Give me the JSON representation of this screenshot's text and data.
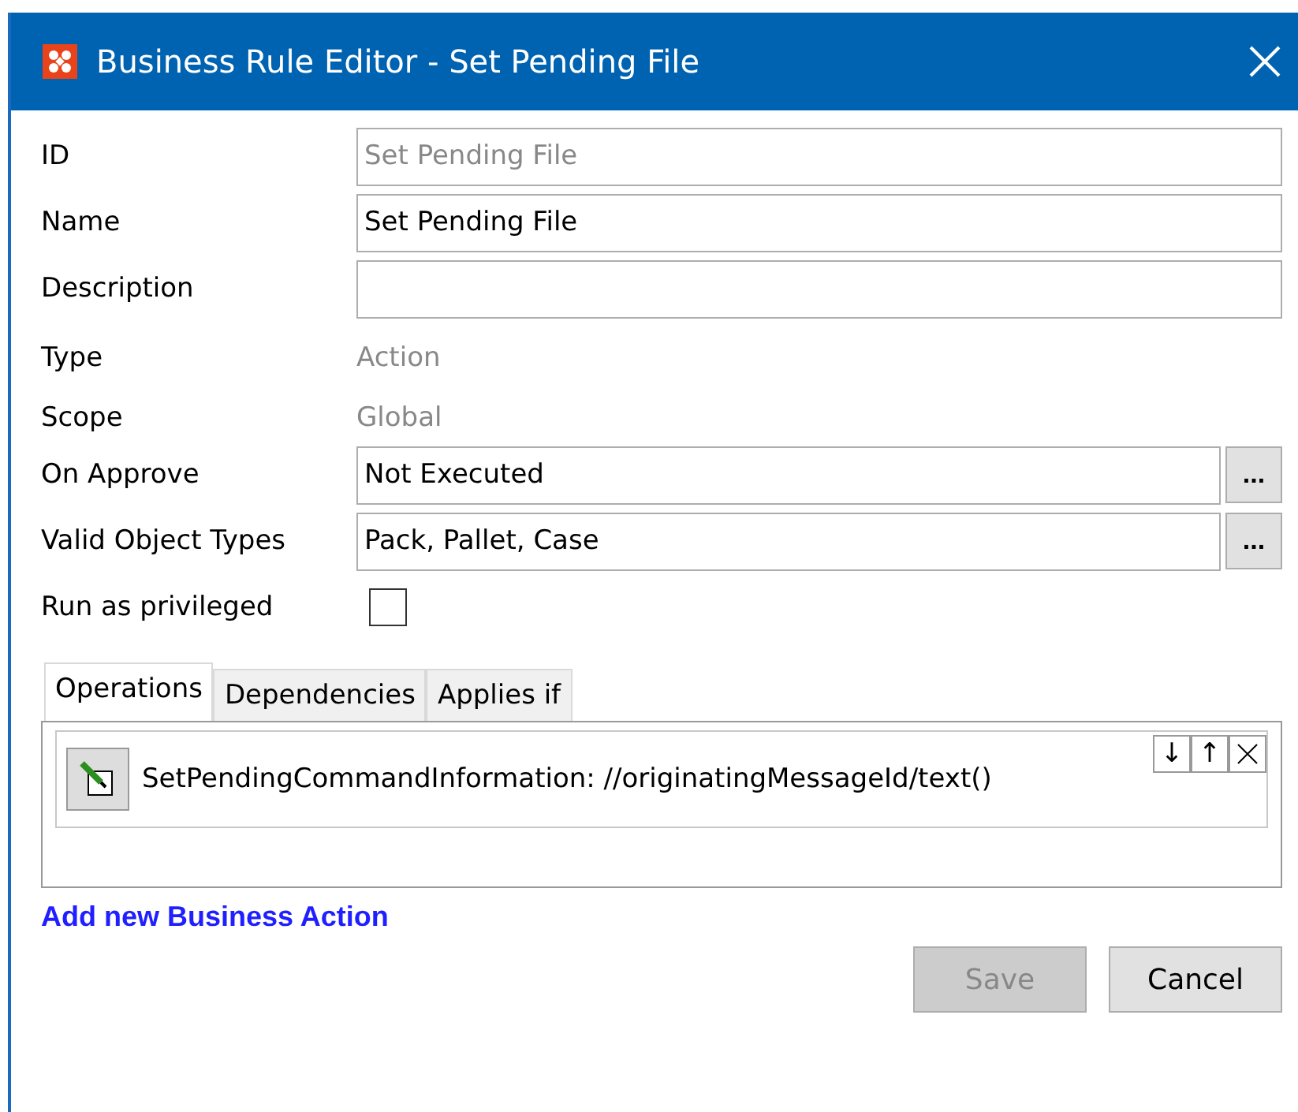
{
  "window": {
    "title": "Business Rule Editor - Set Pending File"
  },
  "fields": [
    {
      "label": "ID",
      "kind": "input",
      "value": "Set Pending File",
      "disabled": true
    },
    {
      "label": "Name",
      "kind": "input",
      "value": "Set Pending File",
      "disabled": false
    },
    {
      "label": "Description",
      "kind": "input"
    },
    {
      "label": "Type",
      "kind": "text",
      "value": "Action"
    },
    {
      "label": "Scope",
      "kind": "text",
      "value": "Global"
    },
    {
      "label": "On Approve",
      "kind": "browse",
      "value": "Not Executed",
      "button": "..."
    },
    {
      "label": "Valid Object Types",
      "kind": "browse",
      "value": "Pack, Pallet, Case",
      "button": "..."
    },
    {
      "label": "Run as privileged",
      "kind": "checkbox",
      "checked": false
    }
  ],
  "tabs": [
    {
      "label": "Operations",
      "selected": true
    },
    {
      "label": "Dependencies",
      "selected": false
    },
    {
      "label": "Applies if",
      "selected": false
    }
  ],
  "operations": [
    {
      "text": "SetPendingCommandInformation: //originatingMessageId/text()",
      "move_down": "↓",
      "move_up": "↑"
    }
  ],
  "add_link": "Add new Business Action",
  "buttons": [
    {
      "label": "Save",
      "disabled": true
    },
    {
      "label": "Cancel",
      "disabled": false
    }
  ]
}
